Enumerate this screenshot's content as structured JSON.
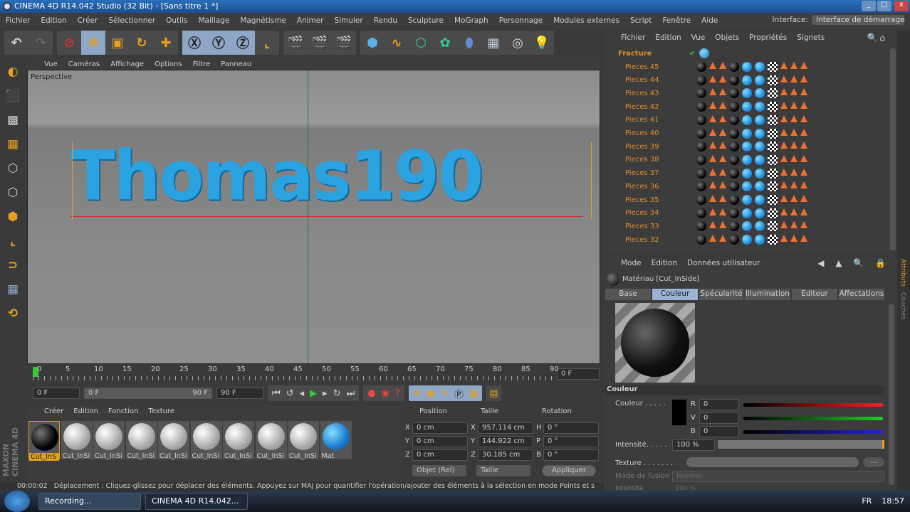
{
  "title": "CINEMA 4D R14.042 Studio (32 Bit) - [Sans titre 1 *]",
  "menu": [
    "Fichier",
    "Edition",
    "Créer",
    "Sélectionner",
    "Outils",
    "Maillage",
    "Magnétisme",
    "Animer",
    "Simuler",
    "Rendu",
    "Sculpture",
    "MoGraph",
    "Personnage",
    "Modules externes",
    "Script",
    "Fenêtre",
    "Aide"
  ],
  "interface": {
    "label": "Interface:",
    "value": "Interface de démarrage"
  },
  "viewport": {
    "menu": [
      "Vue",
      "Caméras",
      "Affichage",
      "Options",
      "Filtre",
      "Panneau"
    ],
    "label": "Perspective",
    "text3d": "Thomas190"
  },
  "timeline": {
    "ticks": [
      "0",
      "5",
      "10",
      "15",
      "20",
      "25",
      "30",
      "35",
      "40",
      "45",
      "50",
      "55",
      "60",
      "65",
      "70",
      "75",
      "80",
      "85",
      "90"
    ],
    "current": "0 F",
    "start": "0 F",
    "range_start": "0 F",
    "range_end": "90 F",
    "end": "90 F"
  },
  "materials": {
    "menu": [
      "Créer",
      "Edition",
      "Fonction",
      "Texture"
    ],
    "items": [
      "Cut_InS",
      "Cut_InSi",
      "Cut_InSi",
      "Cut_InSi",
      "Cut_InSi",
      "Cut_InSi",
      "Cut_InSi",
      "Cut_InSi",
      "Cut_InSi",
      "Mat"
    ]
  },
  "coords": {
    "headers": [
      "Position",
      "Taille",
      "Rotation"
    ],
    "pos": [
      [
        "X",
        "0 cm"
      ],
      [
        "Y",
        "0 cm"
      ],
      [
        "Z",
        "0 cm"
      ]
    ],
    "size": [
      [
        "X",
        "957.114 cm"
      ],
      [
        "Y",
        "144.922 cm"
      ],
      [
        "Z",
        "30.185 cm"
      ]
    ],
    "rot": [
      [
        "H",
        "0 °"
      ],
      [
        "P",
        "0 °"
      ],
      [
        "B",
        "0 °"
      ]
    ],
    "mode": "Objet (Rel)",
    "size_mode": "Taille",
    "apply": "Appliquer"
  },
  "status": {
    "time": "00:00:02",
    "message": "Déplacement : Cliquez-glissez pour déplacer des éléments. Appuyez sur MAJ pour quantifier l'opération/ajouter des éléments à la sélection en mode Points et s"
  },
  "taskbar": {
    "items": [
      "Recording...",
      "CINEMA 4D R14.042..."
    ],
    "lang": "FR",
    "clock": "18:57"
  },
  "objects": {
    "menu": [
      "Fichier",
      "Edition",
      "Vue",
      "Objets",
      "Propriétés",
      "Signets"
    ],
    "root": "Fracture",
    "items": [
      "Pieces 45",
      "Pieces 44",
      "Pieces 43",
      "Pieces 42",
      "Pieces 41",
      "Pieces 40",
      "Pieces 39",
      "Pieces 38",
      "Pieces 37",
      "Pieces 36",
      "Pieces 35",
      "Pieces 34",
      "Pieces 33",
      "Pieces 32"
    ]
  },
  "attributes": {
    "menu": [
      "Mode",
      "Edition",
      "Données utilisateur"
    ],
    "header": "Matériau [Cut_InSide]",
    "tabs": [
      "Base",
      "Couleur",
      "Spécularité",
      "Illumination",
      "Editeur",
      "Affectations"
    ],
    "section": "Couleur",
    "color_label": "Couleur . . . . .",
    "r_label": "R",
    "r": "0",
    "v_label": "V",
    "v": "0",
    "b_label": "B",
    "b": "0",
    "intensity_label": "Intensité. . . . .",
    "intensity": "100 %",
    "texture_label": "Texture . . . . . . .",
    "texture_btn": "...",
    "blend_label": "Mode de fusion",
    "blend": "Normal",
    "intensity2_label": "Intensité",
    "intensity2": "100 %"
  },
  "sidetabs": [
    "Attributs",
    "Couches"
  ]
}
